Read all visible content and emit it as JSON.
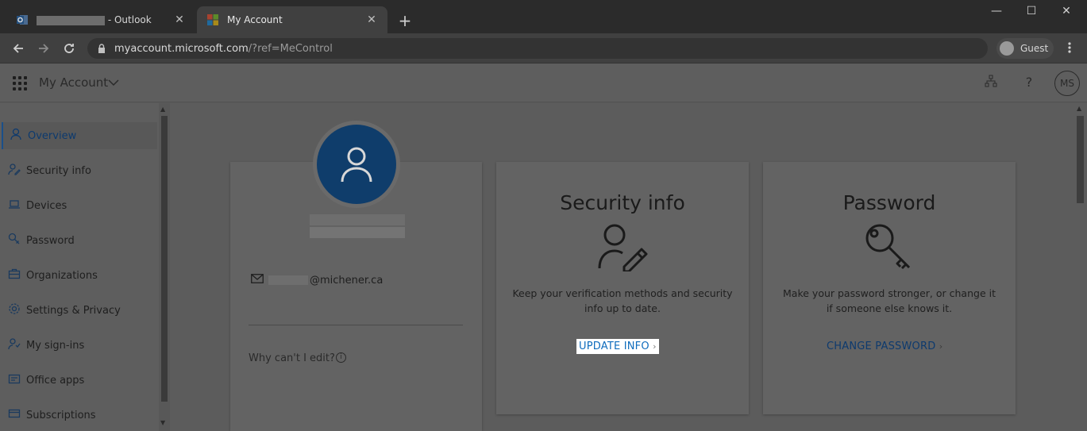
{
  "browser": {
    "tabs": [
      {
        "title": "- Outlook",
        "active": false,
        "close": "✕"
      },
      {
        "title": "My Account",
        "active": true,
        "close": "✕"
      }
    ],
    "new_tab": "+",
    "window_controls": {
      "minimize": "—",
      "maximize": "☐",
      "close": "✕"
    },
    "url_host": "myaccount.microsoft.com",
    "url_rest": "/?ref=MeControl",
    "profile_label": "Guest",
    "menu_icon": "kebab-menu-icon"
  },
  "header": {
    "app_title": "My Account",
    "avatar_initials": "MS"
  },
  "sidebar": {
    "items": [
      {
        "label": "Overview",
        "icon": "person-icon",
        "active": true
      },
      {
        "label": "Security info",
        "icon": "security-info-icon",
        "active": false
      },
      {
        "label": "Devices",
        "icon": "laptop-icon",
        "active": false
      },
      {
        "label": "Password",
        "icon": "key-icon",
        "active": false
      },
      {
        "label": "Organizations",
        "icon": "briefcase-icon",
        "active": false
      },
      {
        "label": "Settings & Privacy",
        "icon": "gear-icon",
        "active": false
      },
      {
        "label": "My sign-ins",
        "icon": "sign-in-icon",
        "active": false
      },
      {
        "label": "Office apps",
        "icon": "office-apps-icon",
        "active": false
      },
      {
        "label": "Subscriptions",
        "icon": "subscriptions-icon",
        "active": false
      }
    ]
  },
  "profile": {
    "email_domain": "@michener.ca",
    "why_cant_edit": "Why can't I edit?"
  },
  "cards": {
    "security": {
      "title": "Security info",
      "description": "Keep your verification methods and security info up to date.",
      "link": "UPDATE INFO"
    },
    "password": {
      "title": "Password",
      "description": "Make your password stronger, or change it if someone else knows it.",
      "link": "CHANGE PASSWORD"
    }
  },
  "colors": {
    "accent": "#0f6cbd",
    "avatar_bg": "#0f3d6b"
  }
}
